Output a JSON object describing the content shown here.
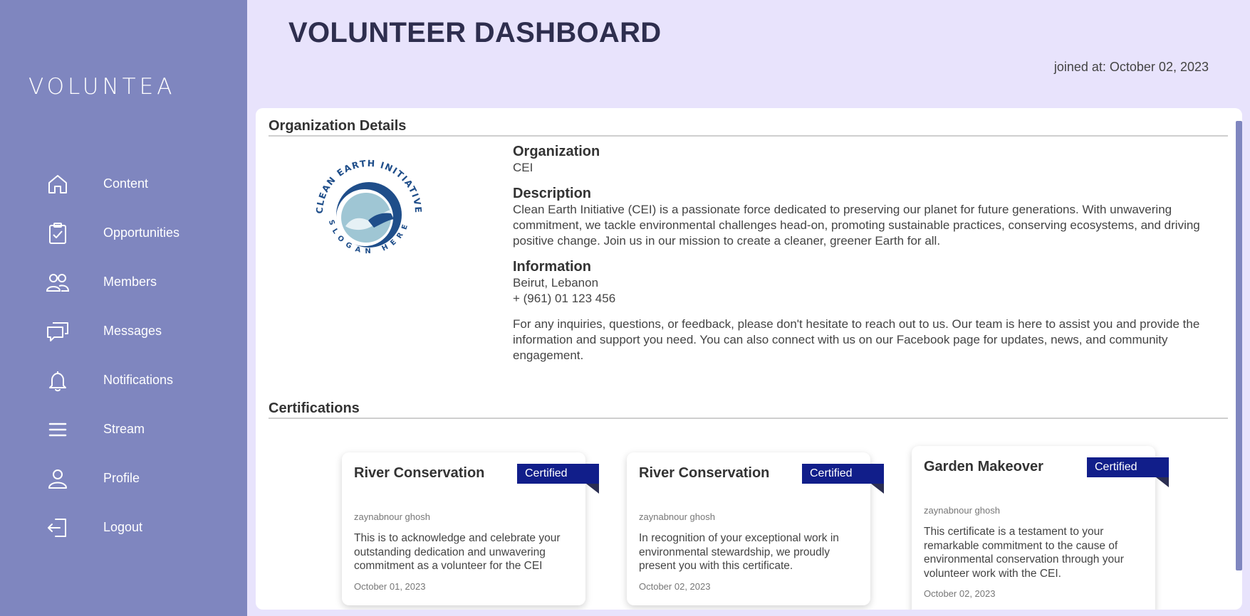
{
  "sidebar": {
    "logo_text": "VOLUNTEA",
    "items": [
      {
        "label": "Content",
        "icon": "home-icon"
      },
      {
        "label": "Opportunities",
        "icon": "clipboard-check-icon"
      },
      {
        "label": "Members",
        "icon": "users-icon"
      },
      {
        "label": "Messages",
        "icon": "chat-bubbles-icon"
      },
      {
        "label": "Notifications",
        "icon": "bell-icon"
      },
      {
        "label": "Stream",
        "icon": "menu-lines-icon"
      },
      {
        "label": "Profile",
        "icon": "user-icon"
      },
      {
        "label": "Logout",
        "icon": "logout-icon"
      }
    ]
  },
  "header": {
    "title": "VOLUNTEER DASHBOARD",
    "joined": "joined at: October 02, 2023"
  },
  "org": {
    "section_title": "Organization Details",
    "logo_text_top": "CLEAN EARTH INITIATIVE",
    "logo_text_bottom": "SLOGAN HERE",
    "organization_heading": "Organization",
    "organization_value": "CEI",
    "description_heading": "Description",
    "description_value": "Clean Earth Initiative (CEI) is a passionate force dedicated to preserving our planet for future generations. With unwavering commitment, we tackle environmental challenges head-on, promoting sustainable practices, conserving ecosystems, and driving positive change. Join us in our mission to create a cleaner, greener Earth for all.",
    "information_heading": "Information",
    "location": "Beirut, Lebanon",
    "phone": "+ (961) 01 123 456",
    "contact_note": "For any inquiries, questions, or feedback, please don't hesitate to reach out to us. Our team is here to assist you and provide the information and support you need. You can also connect with us on our Facebook page for updates, news, and community engagement."
  },
  "certifications": {
    "section_title": "Certifications",
    "items": [
      {
        "title": "River Conservation",
        "badge": "Certified",
        "author": "zaynabnour ghosh",
        "description": "This is to acknowledge and celebrate your outstanding dedication and unwavering commitment as a volunteer for the CEI",
        "date": "October 01, 2023"
      },
      {
        "title": "River Conservation",
        "badge": "Certified",
        "author": "zaynabnour ghosh",
        "description": "In recognition of your exceptional work in environmental stewardship, we proudly present you with this certificate.",
        "date": "October 02, 2023"
      },
      {
        "title": "Garden Makeover",
        "badge": "Certified",
        "author": "zaynabnour ghosh",
        "description": "This certificate is a testament to your remarkable commitment to the cause of environmental conservation through your volunteer work with the CEI.",
        "date": "October 02, 2023"
      }
    ]
  },
  "colors": {
    "sidebar_bg": "#7f86bf",
    "page_bg": "#e8e3fc",
    "badge": "#111e8a"
  }
}
